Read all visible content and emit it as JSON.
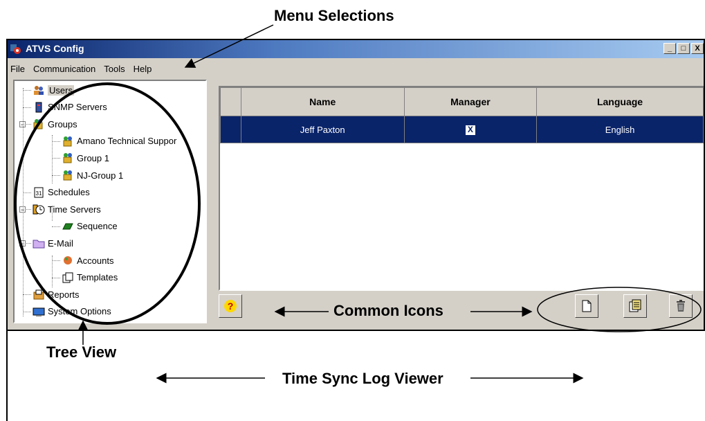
{
  "annotations": {
    "menu_selections": "Menu Selections",
    "tree_view": "Tree View",
    "common_icons": "Common Icons",
    "log_viewer": "Time Sync Log Viewer"
  },
  "window": {
    "title": "ATVS Config",
    "controls": {
      "minimize": "_",
      "maximize": "□",
      "close": "X"
    }
  },
  "menu": [
    "File",
    "Communication",
    "Tools",
    "Help"
  ],
  "tree": {
    "items": [
      {
        "label": "Users",
        "icon": "users-icon",
        "selected": true
      },
      {
        "label": "SNMP Servers",
        "icon": "snmp-server-icon"
      },
      {
        "label": "Groups",
        "icon": "groups-icon",
        "expander": "−"
      },
      {
        "label": "Amano Technical Suppor",
        "icon": "group-icon"
      },
      {
        "label": "Group 1",
        "icon": "group-icon"
      },
      {
        "label": "NJ-Group 1",
        "icon": "group-icon"
      },
      {
        "label": "Schedules",
        "icon": "schedules-icon"
      },
      {
        "label": "Time Servers",
        "icon": "time-servers-icon",
        "expander": "−"
      },
      {
        "label": "Sequence",
        "icon": "sequence-icon"
      },
      {
        "label": "E-Mail",
        "icon": "email-folder-icon",
        "expander": "−"
      },
      {
        "label": "Accounts",
        "icon": "accounts-icon"
      },
      {
        "label": "Templates",
        "icon": "templates-icon"
      },
      {
        "label": "Reports",
        "icon": "reports-icon"
      },
      {
        "label": "System Options",
        "icon": "system-options-icon"
      }
    ]
  },
  "grid": {
    "columns": [
      "",
      "Name",
      "Manager",
      "Language"
    ],
    "rows": [
      {
        "name": "Jeff Paxton",
        "manager": true,
        "manager_mark": "X",
        "language": "English"
      }
    ]
  },
  "toolbar": {
    "help_icon": "help-icon",
    "help_glyph": "?",
    "new_icon": "new-document-icon",
    "edit_icon": "edit-icon",
    "delete_icon": "trash-icon"
  },
  "colors": {
    "titlebar": "#0a246a",
    "selection": "#0a246a",
    "chrome": "#d4d0c8"
  }
}
